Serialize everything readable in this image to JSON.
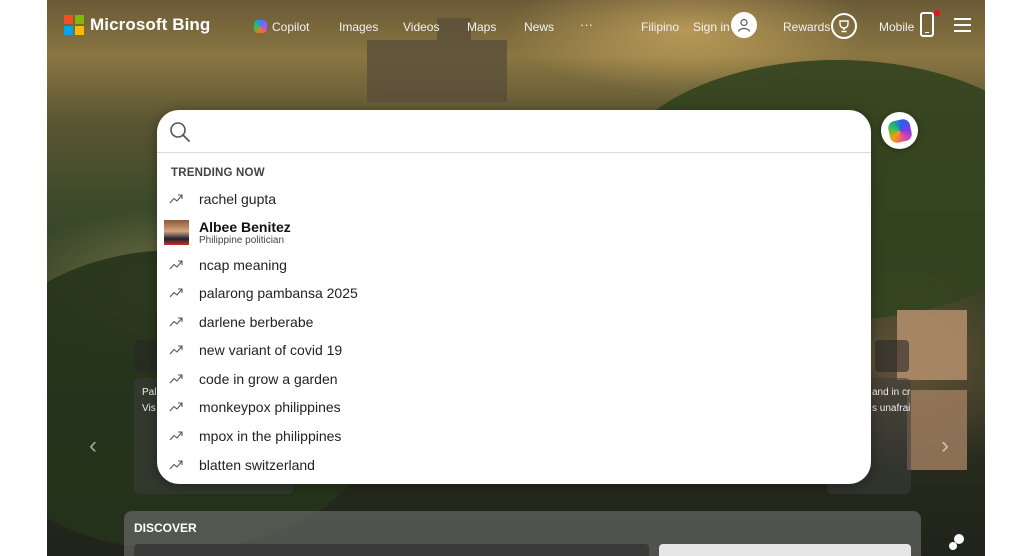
{
  "header": {
    "logo_text": "Microsoft Bing",
    "nav": {
      "copilot": "Copilot",
      "images": "Images",
      "videos": "Videos",
      "maps": "Maps",
      "news": "News",
      "more": "···"
    },
    "language": "Filipino",
    "sign_in": "Sign in",
    "rewards": "Rewards",
    "mobile": "Mobile"
  },
  "search": {
    "value": "",
    "placeholder": ""
  },
  "trending": {
    "heading": "TRENDING NOW",
    "items": [
      "rachel gupta",
      "ncap meaning",
      "palarong pambansa 2025",
      "darlene berberabe",
      "new variant of covid 19",
      "code in grow a garden",
      "monkeypox philippines",
      "mpox in the philippines",
      "blatten switzerland"
    ],
    "entity": {
      "name": "Albee Benitez",
      "description": "Philippine politician"
    }
  },
  "background_cards": {
    "left_text_1": "Pal",
    "left_text_2": "Vis",
    "right_text_1": "and in cr",
    "right_text_2": "s unafrai"
  },
  "discover": {
    "label": "DISCOVER"
  },
  "colors": {
    "ms_red": "#f25022",
    "ms_green": "#7fba00",
    "ms_blue": "#00a4ef",
    "ms_yellow": "#ffb900",
    "notification_dot": "#e81123"
  },
  "icons": {
    "search": "search-icon",
    "trend": "trending-arrow-icon",
    "user": "user-icon",
    "rewards": "trophy-icon",
    "mobile": "phone-icon",
    "menu": "hamburger-menu-icon",
    "copilot": "copilot-icon",
    "chat": "chat-icon"
  }
}
